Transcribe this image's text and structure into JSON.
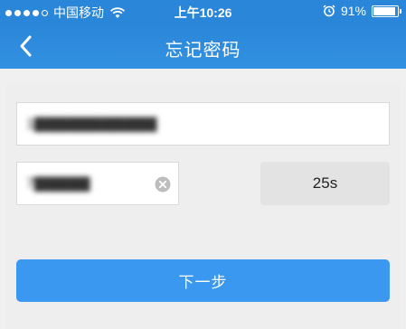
{
  "status_bar": {
    "carrier": "中国移动",
    "time": "上午10:26",
    "battery_percent": "91%",
    "battery_level": 0.91,
    "signal_bars_filled": 4,
    "signal_bars_total": 5,
    "wifi_icon": "wifi-icon",
    "alarm_icon": "alarm-icon"
  },
  "nav": {
    "title": "忘记密码",
    "back_icon": "chevron-left-icon"
  },
  "form": {
    "phone_value": "1▇▇▇▇▇▇▇▇▇▇▇",
    "code_value": "7▇▇▇▇▇",
    "clear_icon": "clear-icon",
    "countdown_label": "25s",
    "next_label": "下一步"
  },
  "colors": {
    "header": "#2a86d8",
    "primary_button": "#3a98f0",
    "background": "#f0f0f0"
  }
}
